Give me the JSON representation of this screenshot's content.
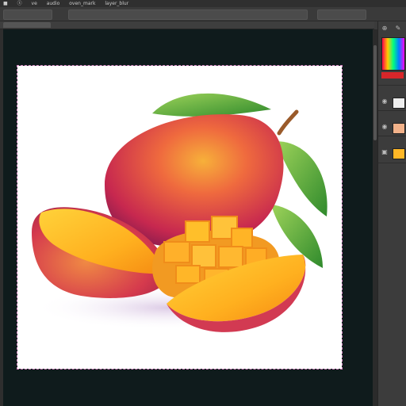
{
  "menubar": {
    "items": [
      "■",
      "ⓢ",
      "ve",
      "audio",
      "oven_mark",
      "layer_blur"
    ]
  },
  "optbar": {
    "boxes": [
      "",
      "",
      ""
    ]
  },
  "document": {
    "tab_label": "",
    "subject": "mango illustration"
  },
  "panel": {
    "icons": [
      "move-icon",
      "brush-icon",
      "eye-icon",
      "layer-thumb-icon",
      "folder-icon"
    ],
    "accent_color": "#d8262a"
  },
  "colors": {
    "pasteboard": "#0f1b1c",
    "ui_dark": "#2f2f2f",
    "ui_mid": "#3b3b3b",
    "marquee": "#d487c1"
  }
}
